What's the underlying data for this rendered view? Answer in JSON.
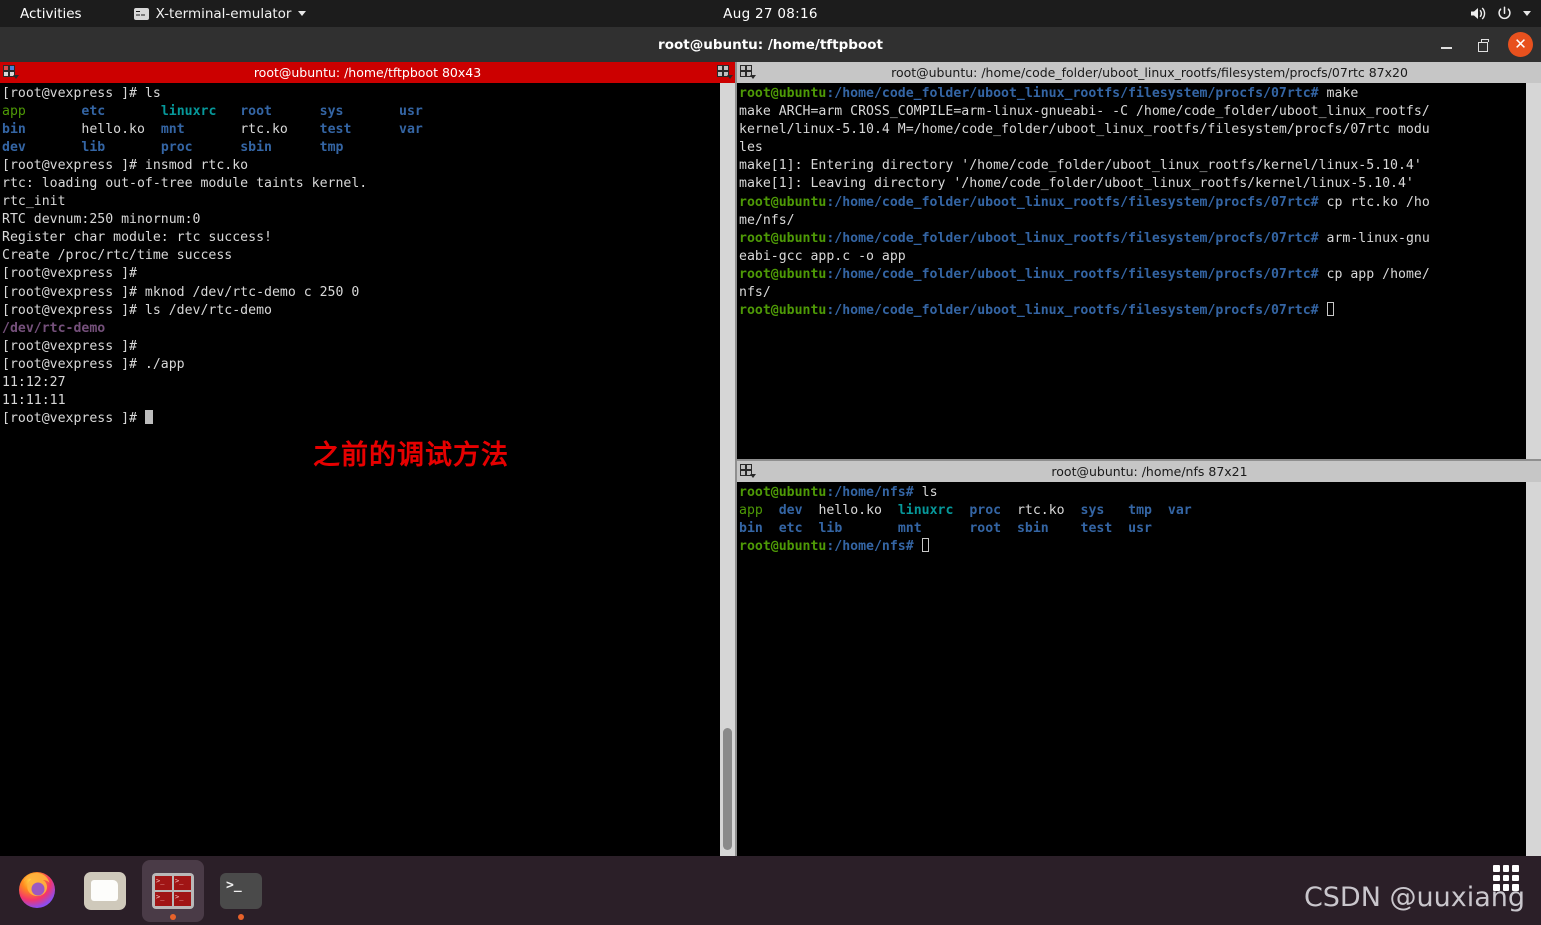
{
  "topbar": {
    "activities": "Activities",
    "app_menu": "X-terminal-emulator",
    "app_icon": "terminal-icon",
    "caret_icon": "chevron-down-icon",
    "clock": "Aug 27  08:16",
    "volume_icon": "volume-icon",
    "power_icon": "power-icon",
    "menu_caret_icon": "chevron-down-icon"
  },
  "window": {
    "title": "root@ubuntu: /home/tftpboot",
    "minimize_label": "–",
    "maximize_label": "❐",
    "close_label": "✕",
    "minimize_icon": "minimize-icon",
    "maximize_icon": "maximize-icon",
    "close_icon": "close-icon"
  },
  "panes": {
    "left": {
      "title": "root@ubuntu: /home/tftpboot 80x43",
      "active": true,
      "handle_icon": "pane-layout-icon",
      "annotation": "之前的调试方法",
      "lines": [
        "[root@vexpress ]# ls",
        "app       etc       linuxrc   root      sys       usr",
        "bin       hello.ko  mnt       rtc.ko    test      var",
        "dev       lib       proc      sbin      tmp",
        "[root@vexpress ]# insmod rtc.ko",
        "rtc: loading out-of-tree module taints kernel.",
        "rtc_init",
        "RTC devnum:250 minornum:0",
        "Register char module: rtc success!",
        "Create /proc/rtc/time success",
        "[root@vexpress ]#",
        "[root@vexpress ]# mknod /dev/rtc-demo c 250 0",
        "[root@vexpress ]# ls /dev/rtc-demo",
        "/dev/rtc-demo",
        "[root@vexpress ]#",
        "[root@vexpress ]# ./app",
        "11:12:27",
        "11:11:11",
        "[root@vexpress ]#"
      ]
    },
    "top_right": {
      "title": "root@ubuntu: /home/code_folder/uboot_linux_rootfs/filesystem/procfs/07rtc 87x20",
      "active": false,
      "handle_icon": "pane-layout-icon",
      "prompt": "root@ubuntu",
      "cwd": ":/home/code_folder/uboot_linux_rootfs/filesystem/procfs/07rtc#",
      "lines": [
        {
          "type": "prompt",
          "cmd": " make"
        },
        {
          "type": "out",
          "text": "make ARCH=arm CROSS_COMPILE=arm-linux-gnueabi- -C /home/code_folder/uboot_linux_rootfs/"
        },
        {
          "type": "out",
          "text": "kernel/linux-5.10.4 M=/home/code_folder/uboot_linux_rootfs/filesystem/procfs/07rtc modu"
        },
        {
          "type": "out",
          "text": "les"
        },
        {
          "type": "out",
          "text": "make[1]: Entering directory '/home/code_folder/uboot_linux_rootfs/kernel/linux-5.10.4'"
        },
        {
          "type": "out",
          "text": "make[1]: Leaving directory '/home/code_folder/uboot_linux_rootfs/kernel/linux-5.10.4'"
        },
        {
          "type": "prompt",
          "cmd": " cp rtc.ko /ho"
        },
        {
          "type": "out",
          "text": "me/nfs/"
        },
        {
          "type": "prompt",
          "cmd": " arm-linux-gnu"
        },
        {
          "type": "out",
          "text": "eabi-gcc app.c -o app"
        },
        {
          "type": "prompt",
          "cmd": " cp app /home/"
        },
        {
          "type": "out",
          "text": "nfs/"
        },
        {
          "type": "prompt",
          "cmd": " ",
          "cursor": true
        }
      ]
    },
    "bottom_right": {
      "title": "root@ubuntu: /home/nfs 87x21",
      "active": false,
      "handle_icon": "pane-layout-icon",
      "prompt": "root@ubuntu",
      "cwd": ":/home/nfs#",
      "lines": [
        {
          "type": "prompt",
          "cmd": " ls"
        },
        {
          "type": "ls1"
        },
        {
          "type": "ls2"
        },
        {
          "type": "prompt",
          "cmd": " ",
          "cursor": true
        }
      ],
      "listing_row1": "app  dev  hello.ko  linuxrc  proc  rtc.ko  sys   tmp  var",
      "listing_row2": "bin  etc  lib       mnt      root  sbin    test  usr"
    }
  },
  "dock": {
    "items": [
      {
        "name": "firefox",
        "icon": "firefox-icon",
        "running": false,
        "active": false
      },
      {
        "name": "files",
        "icon": "files-icon",
        "running": false,
        "active": false
      },
      {
        "name": "terminator",
        "icon": "terminator-icon",
        "running": true,
        "active": true
      },
      {
        "name": "terminal",
        "icon": "terminal-icon",
        "running": true,
        "active": false
      }
    ]
  },
  "watermark": {
    "text": "CSDN @uuxiang",
    "appgrid_icon": "app-grid-icon"
  },
  "colors": {
    "active_pane_title": "#cc0000",
    "inactive_pane_title": "#c6c6c6",
    "close_button": "#e8511e",
    "annotation": "#e60000",
    "dock_bg": "#2b1f28",
    "prompt_green": "#4e9a06",
    "prompt_blue": "#3465a4"
  }
}
